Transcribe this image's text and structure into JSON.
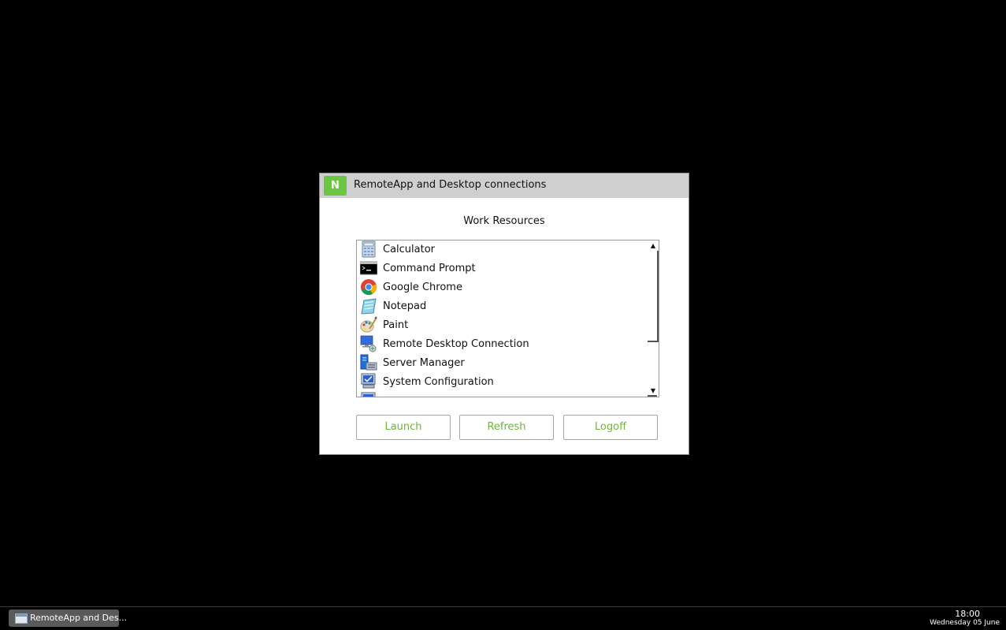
{
  "dialog": {
    "title": "RemoteApp and Desktop connections",
    "logo_icon": "nx-logo-icon",
    "heading": "Work Resources",
    "resources": [
      {
        "label": "Calculator",
        "icon": "calculator-icon"
      },
      {
        "label": "Command Prompt",
        "icon": "command-prompt-icon"
      },
      {
        "label": "Google Chrome",
        "icon": "chrome-icon"
      },
      {
        "label": "Notepad",
        "icon": "notepad-icon"
      },
      {
        "label": "Paint",
        "icon": "paint-icon"
      },
      {
        "label": "Remote Desktop Connection",
        "icon": "remote-desktop-icon"
      },
      {
        "label": "Server Manager",
        "icon": "server-manager-icon"
      },
      {
        "label": "System Configuration",
        "icon": "system-configuration-icon"
      }
    ],
    "buttons": {
      "launch": "Launch",
      "refresh": "Refresh",
      "logoff": "Logoff"
    },
    "accent_color": "#6db33f"
  },
  "taskbar": {
    "task_label": "RemoteApp and Des...",
    "time": "18:00",
    "date": "Wednesday 05 June"
  }
}
